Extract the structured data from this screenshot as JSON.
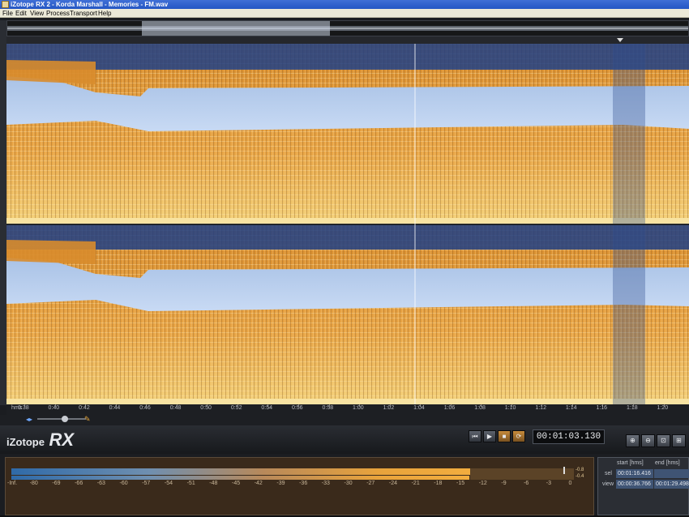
{
  "window": {
    "title": "iZotope RX 2 - Korda Marshall - Memories - FM.wav"
  },
  "menu": [
    {
      "label": "File"
    },
    {
      "label": "Edit"
    },
    {
      "label": "View"
    },
    {
      "label": "Process"
    },
    {
      "label": "Transport"
    },
    {
      "label": "Help"
    }
  ],
  "time_axis": {
    "unit_label": "hms",
    "ticks": [
      "0:38",
      "0:40",
      "0:42",
      "0:44",
      "0:46",
      "0:48",
      "0:50",
      "0:52",
      "0:54",
      "0:56",
      "0:58",
      "1:00",
      "1:02",
      "1:04",
      "1:06",
      "1:08",
      "1:10",
      "1:12",
      "1:14",
      "1:16",
      "1:18",
      "1:20"
    ]
  },
  "brand": {
    "logo_text": "iZotope",
    "product_text": "RX"
  },
  "transport": {
    "timecode": "00:01:03.130",
    "buttons": [
      {
        "name": "skip-to-start-button",
        "icon": "skip-start-icon"
      },
      {
        "name": "play-button",
        "icon": "play-icon"
      },
      {
        "name": "stop-button",
        "icon": "stop-icon"
      },
      {
        "name": "loop-button",
        "icon": "loop-icon"
      }
    ]
  },
  "zoom_buttons": [
    {
      "name": "zoom-in-button",
      "icon": "magnifier-plus-icon"
    },
    {
      "name": "zoom-out-button",
      "icon": "magnifier-minus-icon"
    },
    {
      "name": "zoom-selection-button",
      "icon": "magnifier-selection-icon"
    },
    {
      "name": "zoom-full-button",
      "icon": "magnifier-full-icon"
    },
    {
      "name": "zoom-vertical-button",
      "icon": "magnifier-vertical-icon"
    }
  ],
  "meter": {
    "scale": [
      "-Inf.",
      "-80",
      "-69",
      "-66",
      "-63",
      "-60",
      "-57",
      "-54",
      "-51",
      "-48",
      "-45",
      "-42",
      "-39",
      "-36",
      "-33",
      "-30",
      "-27",
      "-24",
      "-21",
      "-18",
      "-15",
      "-12",
      "-9",
      "-6",
      "-3",
      "0"
    ],
    "peak_left": "-0.8",
    "peak_right": "-0.4",
    "colors": {
      "low": "#2f6aa8",
      "high": "#f2ad3e",
      "panel": "#3a2a1b"
    }
  },
  "selection": {
    "col_start": "start [hms]",
    "col_end": "end [hms]",
    "rows": [
      {
        "label": "sel",
        "start": "00:01:16.416",
        "end": ""
      },
      {
        "label": "view",
        "start": "00:00:36.766",
        "end": "00:01:29.498"
      }
    ]
  },
  "colors": {
    "accent": "#f2ad3e",
    "spectrogram_blue": "#1e3f86",
    "spectrogram_light": "#b6cef0"
  }
}
